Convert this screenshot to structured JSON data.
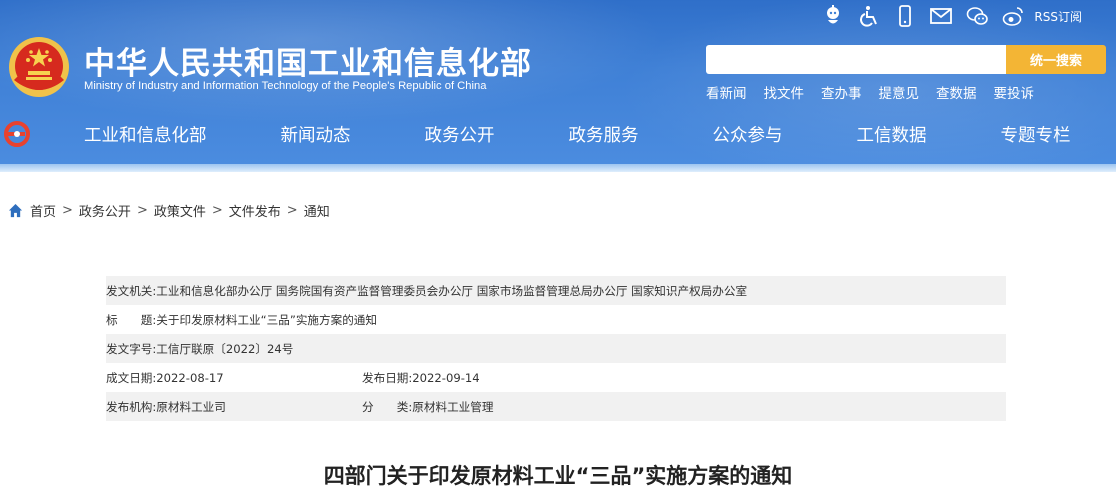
{
  "header": {
    "title": "中华人民共和国工业和信息化部",
    "subtitle": "Ministry of Industry and Information Technology of the People's Republic of China",
    "top_icons": [
      "robot-assistant-icon",
      "accessibility-icon",
      "mobile-icon",
      "mail-icon",
      "wechat-icon",
      "weibo-icon"
    ],
    "rss_label": "RSS订阅",
    "search": {
      "placeholder": "",
      "button_label": "统一搜索"
    },
    "quick_links": [
      "看新闻",
      "找文件",
      "查办事",
      "提意见",
      "查数据",
      "要投诉"
    ],
    "nav": [
      "工业和信息化部",
      "新闻动态",
      "政务公开",
      "政务服务",
      "公众参与",
      "工信数据",
      "专题专栏"
    ]
  },
  "breadcrumb": [
    "首页",
    "政务公开",
    "政策文件",
    "文件发布",
    "通知"
  ],
  "info": {
    "issuer_label": "发文机关:",
    "issuer_value": "工业和信息化部办公厅 国务院国有资产监督管理委员会办公厅 国家市场监督管理总局办公厅 国家知识产权局办公室",
    "title_label": "标　　题:",
    "title_value": "关于印发原材料工业“三品”实施方案的通知",
    "docno_label": "发文字号:",
    "docno_value": "工信厅联原〔2022〕24号",
    "written_label": "成文日期:",
    "written_value": "2022-08-17",
    "published_label": "发布日期:",
    "published_value": "2022-09-14",
    "org_label": "发布机构:",
    "org_value": "原材料工业司",
    "category_label": "分　　类:",
    "category_value": "原材料工业管理"
  },
  "document_title": "四部门关于印发原材料工业“三品”实施方案的通知",
  "colors": {
    "header_blue": "#3f80d6",
    "search_button": "#f3b535",
    "row_shade": "#f1f1f1"
  }
}
